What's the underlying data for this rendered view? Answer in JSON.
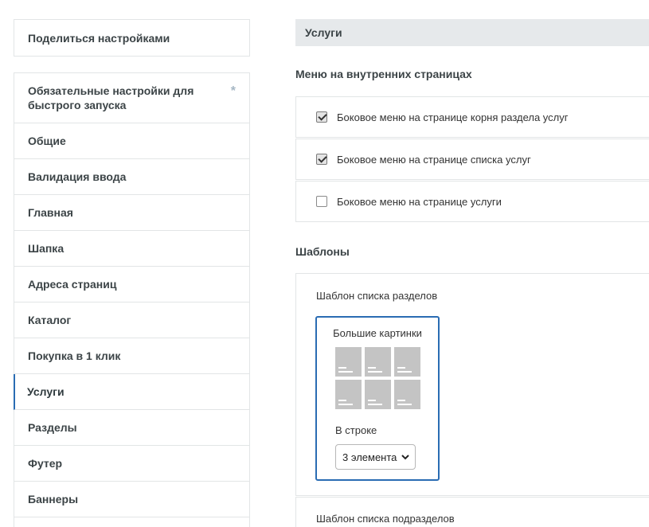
{
  "sidebar": {
    "share_label": "Поделиться настройками",
    "items": [
      {
        "label": "Обязательные настройки для быстрого запуска",
        "marker": "*"
      },
      {
        "label": "Общие"
      },
      {
        "label": "Валидация ввода"
      },
      {
        "label": "Главная"
      },
      {
        "label": "Шапка"
      },
      {
        "label": "Адреса страниц"
      },
      {
        "label": "Каталог"
      },
      {
        "label": "Покупка в 1 клик"
      },
      {
        "label": "Услуги",
        "active": true
      },
      {
        "label": "Разделы"
      },
      {
        "label": "Футер"
      },
      {
        "label": "Баннеры"
      }
    ]
  },
  "main": {
    "section_title": "Услуги",
    "menu_heading": "Меню на внутренних страницах",
    "menu_options": [
      {
        "label": "Боковое меню на странице корня раздела услуг",
        "checked": true
      },
      {
        "label": "Боковое меню на странице списка услуг",
        "checked": true
      },
      {
        "label": "Боковое меню на странице услуги",
        "checked": false
      }
    ],
    "templates_heading": "Шаблоны",
    "sections_template": {
      "label": "Шаблон списка разделов",
      "card_title": "Большие картинки",
      "per_row_label": "В строке",
      "per_row_value": "3 элемента"
    },
    "subsections_template": {
      "label": "Шаблон списка подразделов"
    }
  },
  "colors": {
    "accent": "#2a6cb3",
    "header_bg": "#e6e9eb",
    "border": "#e2e5e6",
    "thumb": "#c4c4c4"
  }
}
